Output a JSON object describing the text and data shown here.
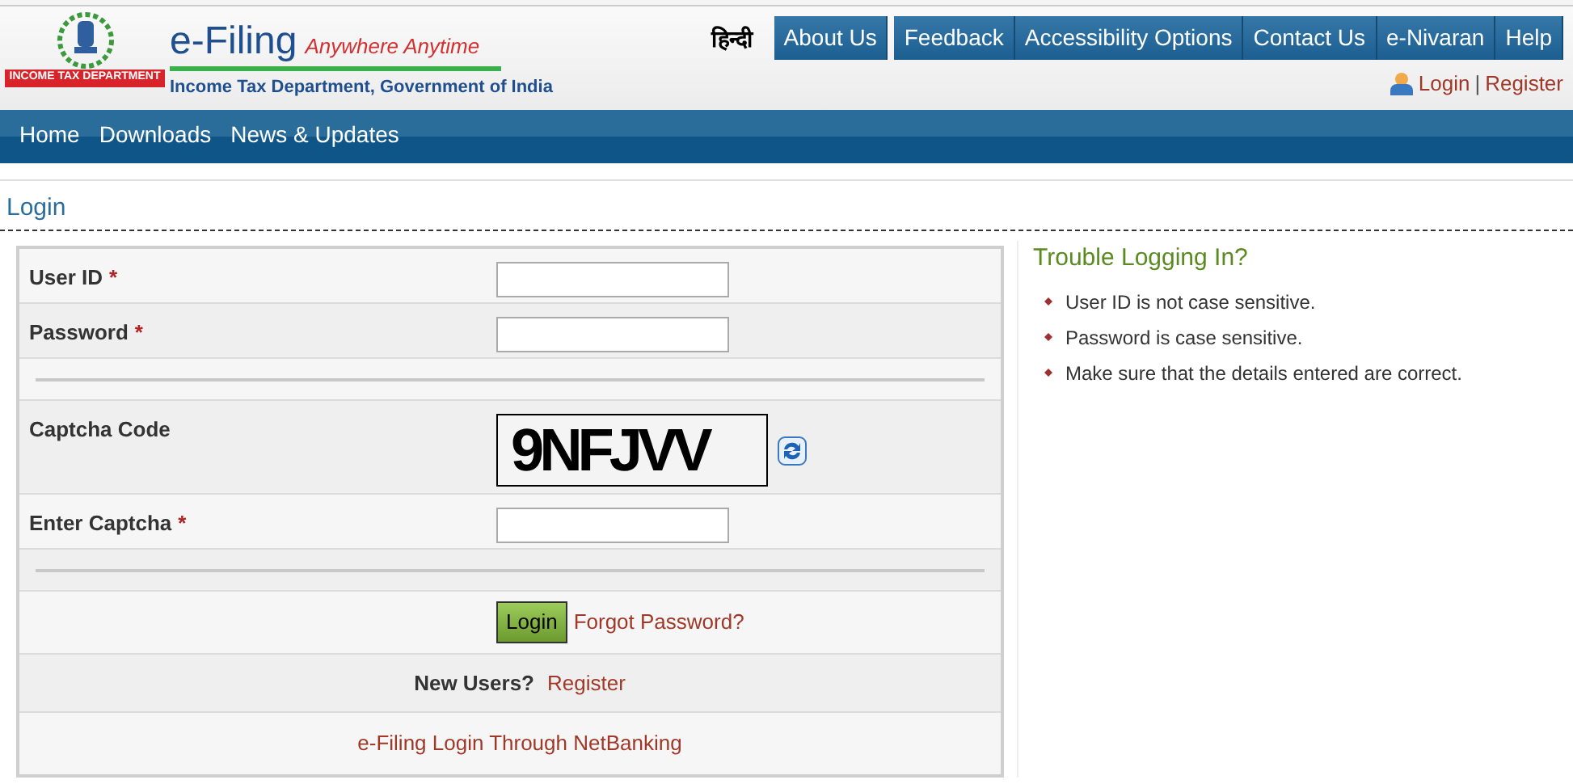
{
  "header": {
    "logo_ribbon": "INCOME TAX DEPARTMENT",
    "brand": "e-Filing",
    "tagline": "Anywhere Anytime",
    "subtitle": "Income Tax Department, Government of India",
    "language_link": "हिन्दी",
    "top_menu": [
      "About Us",
      "Feedback",
      "Accessibility Options",
      "Contact Us",
      "e-Nivaran",
      "Help"
    ],
    "account_links": [
      "Login",
      "Register"
    ],
    "account_separator": "|"
  },
  "nav": [
    "Home",
    "Downloads",
    "News & Updates"
  ],
  "page_title": "Login",
  "form": {
    "rows": [
      {
        "kind": "input",
        "label": "User ID",
        "required_mark": "*"
      },
      {
        "kind": "input",
        "label": "Password",
        "required_mark": "*"
      },
      {
        "kind": "separator"
      },
      {
        "kind": "captcha",
        "label": "Captcha Code",
        "code": "9NFJVV"
      },
      {
        "kind": "input",
        "label": "Enter Captcha",
        "required_mark": "*"
      },
      {
        "kind": "separator"
      },
      {
        "kind": "actions",
        "button": "Login",
        "link": "Forgot Password?"
      },
      {
        "kind": "register",
        "label": "New Users?",
        "link": "Register"
      },
      {
        "kind": "link",
        "link": "e-Filing Login Through NetBanking"
      }
    ]
  },
  "help": {
    "title": "Trouble Logging In?",
    "items": [
      "User ID is not case sensitive.",
      "Password is case sensitive.",
      "Make sure that the details entered are correct."
    ]
  }
}
